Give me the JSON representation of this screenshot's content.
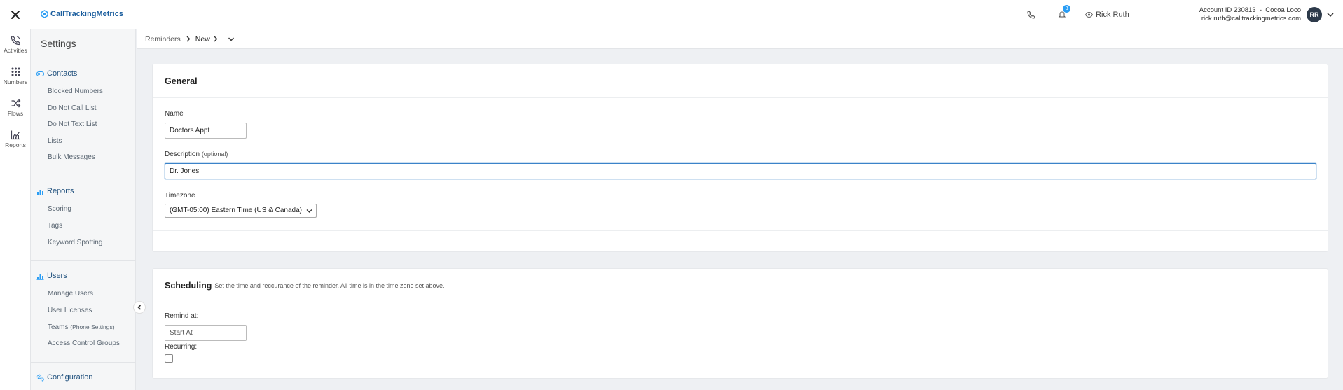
{
  "topbar": {
    "logo_text": "CallTrackingMetrics",
    "notification_count": "3",
    "user_name": "Rick Ruth",
    "account_line": "Account ID 230813  -  Cocoa Loco",
    "email": "rick.ruth@calltrackingmetrics.com",
    "avatar_initials": "RR"
  },
  "rail": {
    "items": [
      {
        "label": "Activities",
        "icon": "phone-icon"
      },
      {
        "label": "Numbers",
        "icon": "grid-icon"
      },
      {
        "label": "Flows",
        "icon": "shuffle-icon"
      },
      {
        "label": "Reports",
        "icon": "chart-icon"
      }
    ]
  },
  "settings": {
    "title": "Settings",
    "contacts": {
      "heading": "Contacts",
      "items": [
        "Blocked Numbers",
        "Do Not Call List",
        "Do Not Text List",
        "Lists",
        "Bulk Messages"
      ]
    },
    "reports": {
      "heading": "Reports",
      "items": [
        "Scoring",
        "Tags",
        "Keyword Spotting"
      ]
    },
    "users": {
      "heading": "Users",
      "items": [
        "Manage Users",
        "User Licenses",
        "Teams",
        "Access Control Groups"
      ],
      "teams_suffix": "(Phone Settings)"
    },
    "configuration": {
      "heading": "Configuration"
    }
  },
  "breadcrumb": {
    "root": "Reminders",
    "current": "New"
  },
  "general": {
    "title": "General",
    "name_label": "Name",
    "name_value": "Doctors Appt",
    "description_label": "Description",
    "description_optional": "(optional)",
    "description_value": "Dr. Jones",
    "timezone_label": "Timezone",
    "timezone_value": "(GMT-05:00) Eastern Time (US & Canada)"
  },
  "scheduling": {
    "title": "Scheduling",
    "subtitle": "Set the time and reccurance of the reminder. All time is in the time zone set above.",
    "remind_label": "Remind at:",
    "remind_placeholder": "Start At",
    "recurring_label": "Recurring:",
    "recurring_checked": false
  },
  "colors": {
    "accent": "#2a9df4",
    "nav_heading": "#1e4f7c",
    "focus_border": "#3b83c9"
  }
}
